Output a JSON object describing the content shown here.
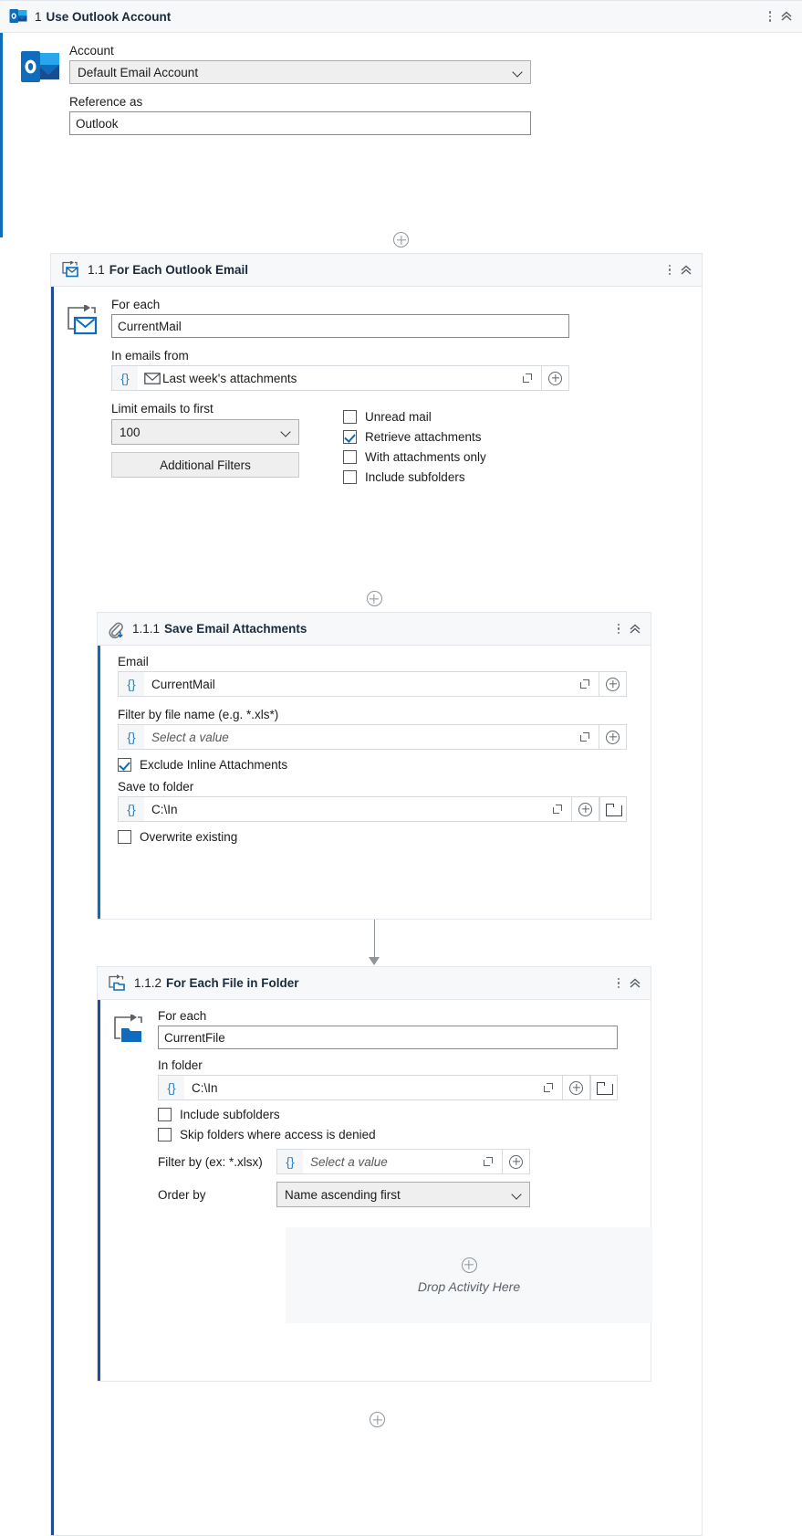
{
  "root": {
    "index": "1",
    "title": "Use Outlook Account",
    "icon": "outlook-icon",
    "account_label": "Account",
    "account_value": "Default Email Account",
    "reference_label": "Reference as",
    "reference_value": "Outlook"
  },
  "for_each_email": {
    "index": "1.1",
    "title": "For Each Outlook Email",
    "for_each_label": "For each",
    "for_each_value": "CurrentMail",
    "in_emails_label": "In emails from",
    "in_emails_value": "Last week's attachments",
    "limit_label": "Limit emails to first",
    "limit_value": "100",
    "additional_filters_label": "Additional Filters",
    "checkboxes": [
      {
        "label": "Unread mail",
        "checked": false
      },
      {
        "label": "Retrieve attachments",
        "checked": true
      },
      {
        "label": "With attachments only",
        "checked": false
      },
      {
        "label": "Include subfolders",
        "checked": false
      }
    ]
  },
  "save_attachments": {
    "index": "1.1.1",
    "title": "Save Email Attachments",
    "email_label": "Email",
    "email_value": "CurrentMail",
    "filter_label": "Filter by file name (e.g. *.xls*)",
    "filter_placeholder": "Select a value",
    "exclude_inline_label": "Exclude Inline Attachments",
    "exclude_inline_checked": true,
    "save_folder_label": "Save to folder",
    "save_folder_value": "C:\\In",
    "overwrite_label": "Overwrite existing",
    "overwrite_checked": false
  },
  "for_each_file": {
    "index": "1.1.2",
    "title": "For Each File in Folder",
    "for_each_label": "For each",
    "for_each_value": "CurrentFile",
    "in_folder_label": "In folder",
    "in_folder_value": "C:\\In",
    "include_subfolders_label": "Include subfolders",
    "include_subfolders_checked": false,
    "skip_denied_label": "Skip folders where access is denied",
    "skip_denied_checked": false,
    "filter_label": "Filter by (ex: *.xlsx)",
    "filter_placeholder": "Select a value",
    "order_by_label": "Order by",
    "order_by_value": "Name ascending first",
    "drop_text": "Drop Activity Here"
  },
  "icons": {
    "kebab": "more-options-icon",
    "collapse": "collapse-chevron-icon",
    "braces": "{}",
    "expand": "expand-editor-icon",
    "plus": "add-icon",
    "folder": "browse-folder-icon"
  },
  "colors": {
    "accent_blue": "#0f6cbd",
    "accent_navy": "#1f4e96",
    "header_bg": "#f7f8f9",
    "border": "#e3e6ea"
  }
}
